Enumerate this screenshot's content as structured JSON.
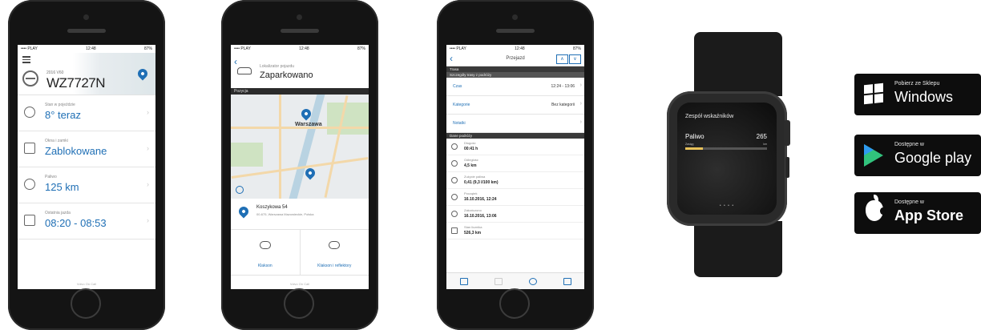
{
  "accent": "#1f6fb5",
  "phone1": {
    "status": {
      "carrier": "•••• PLAY",
      "time": "12:48",
      "battery": "87%"
    },
    "car_model": "2016 V60",
    "plate": "WZ7727N",
    "rows": [
      {
        "label": "Stan w pojeździe",
        "value": "8° teraz",
        "icon": "temperature-icon"
      },
      {
        "label": "Okna i zamki",
        "value": "Zablokowane",
        "icon": "lock-icon"
      },
      {
        "label": "Paliwo",
        "value": "125 km",
        "icon": "gauge-icon"
      },
      {
        "label": "Ostatnia jazda",
        "value": "08:20 - 08:53",
        "icon": "journal-icon"
      }
    ],
    "footer": "Volvo On Call"
  },
  "phone2": {
    "status": {
      "carrier": "•••• PLAY",
      "time": "12:48",
      "battery": "87%"
    },
    "title_label": "Lokalizator pojazdu",
    "title_value": "Zaparkowano",
    "section": "Pozycja",
    "map_city": "Warszawa",
    "address_line1": "Koszykowa 54",
    "address_line2": "00-675, Warszawa Mazowieckie, Polska",
    "button_left": "Klakson",
    "button_right": "Klakson i reflektory",
    "footer": "Volvo On Call"
  },
  "phone3": {
    "status": {
      "carrier": "•••• PLAY",
      "time": "12:48",
      "battery": "87%"
    },
    "nav_title": "Przejazd",
    "arrow_up": "∧",
    "arrow_down": "∨",
    "section1": "Trasa",
    "section1_sub": "Szczegóły trasy z podróży",
    "rows": [
      {
        "key": "Czas",
        "value": "12:24 - 13:06"
      },
      {
        "key": "Kategorie",
        "value": "Bez kategorii"
      },
      {
        "key": "Notatki",
        "value": ""
      }
    ],
    "section2": "Dane podróży",
    "items": [
      {
        "label": "Długość",
        "value": "00:41 h"
      },
      {
        "label": "Odległość",
        "value": "4,5 km"
      },
      {
        "label": "Zużycie paliwa",
        "value": "0,41 (9,3 l/100 km)"
      },
      {
        "label": "Początek",
        "value": "16.10.2016, 12:24"
      },
      {
        "label": "Zakończono",
        "value": "16.10.2016, 13:06"
      },
      {
        "label": "Stan licznika",
        "value": "526,3 km"
      }
    ]
  },
  "watch": {
    "title": "Zespół wskaźników",
    "label": "Paliwo",
    "value": "265",
    "bar_left": "Zasięg",
    "bar_right": "km",
    "fuel_fraction": 0.22,
    "pager": "• • • •"
  },
  "badges": {
    "windows": {
      "small": "Pobierz ze Sklepu",
      "big": "Windows"
    },
    "google": {
      "small": "Dostępne w",
      "big": "Google play"
    },
    "apple": {
      "small": "Dostępne w",
      "big": "App Store"
    }
  }
}
